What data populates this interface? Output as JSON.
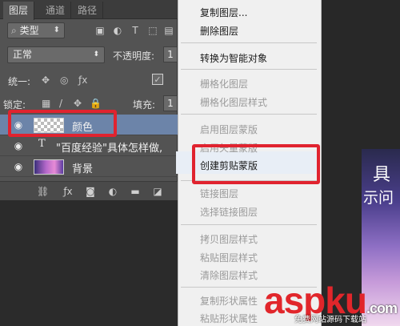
{
  "tabs": [
    "图层",
    "通道",
    "路径"
  ],
  "filter": {
    "kind_label": "类型"
  },
  "blend": {
    "mode": "正常",
    "opacity_label": "不透明度:",
    "opacity_value": "1"
  },
  "unify_label": "统一:",
  "lock_label": "锁定:",
  "fill": {
    "label": "填充:",
    "value": "1"
  },
  "layers": [
    {
      "name": "颜色",
      "type": "shape",
      "selected": true
    },
    {
      "name": "\"百度经验\"具体怎样做,",
      "type": "text",
      "selected": false
    },
    {
      "name": "背景",
      "type": "image",
      "selected": false
    }
  ],
  "context_menu": [
    {
      "label": "复制图层...",
      "enabled": true
    },
    {
      "label": "删除图层",
      "enabled": true
    },
    {
      "label": "转换为智能对象",
      "enabled": true
    },
    {
      "label": "栅格化图层",
      "enabled": false
    },
    {
      "label": "栅格化图层样式",
      "enabled": false
    },
    {
      "label": "启用图层蒙版",
      "enabled": false
    },
    {
      "label": "启用矢量蒙版",
      "enabled": false
    },
    {
      "label": "创建剪贴蒙版",
      "enabled": true
    },
    {
      "label": "链接图层",
      "enabled": false
    },
    {
      "label": "选择链接图层",
      "enabled": false
    },
    {
      "label": "拷贝图层样式",
      "enabled": false
    },
    {
      "label": "粘贴图层样式",
      "enabled": false
    },
    {
      "label": "清除图层样式",
      "enabled": false
    },
    {
      "label": "复制形状属性",
      "enabled": false
    },
    {
      "label": "粘贴形状属性",
      "enabled": false
    }
  ],
  "image_text": [
    "具",
    "示问"
  ],
  "watermark": {
    "main": "aspku",
    "tld": ".com",
    "sub": "免费网站源码下载站"
  },
  "colors": {
    "highlight_box": "#e0232f",
    "selected_layer": "#6c84a9",
    "watermark": "#e1262b"
  },
  "icons": [
    "eye-icon",
    "link-icon",
    "fx-icon",
    "mask-icon",
    "adjustment-icon",
    "folder-icon",
    "new-layer-icon",
    "trash-icon",
    "lock-icon",
    "brush-icon",
    "move-icon"
  ]
}
